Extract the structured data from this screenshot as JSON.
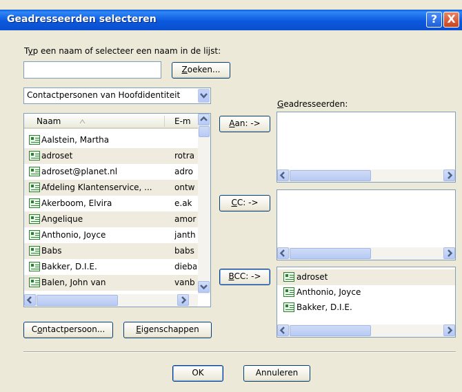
{
  "window": {
    "title": "Geadresseerden selecteren"
  },
  "title_controls": {
    "help": "?",
    "close": "X"
  },
  "search": {
    "prompt_prefix": "T",
    "prompt_ul": "y",
    "prompt_rest": "p een naam of selecteer een naam in de lijst:",
    "value": "",
    "button_ul": "Z",
    "button_rest": "oeken..."
  },
  "addressbook_combo": {
    "selected": "Contactpersonen van Hoofdidentiteit"
  },
  "contacts_list": {
    "columns": [
      "Naam",
      "E-m"
    ],
    "rows": [
      {
        "name": "Aalstein, Martha",
        "email": ""
      },
      {
        "name": "adroset",
        "email": "rotra"
      },
      {
        "name": "adroset@planet.nl",
        "email": "adro"
      },
      {
        "name": "Afdeling Klantenservice, ...",
        "email": "ontw"
      },
      {
        "name": "Akerboom, Elvira",
        "email": "e.ak"
      },
      {
        "name": "Angelique",
        "email": "amor"
      },
      {
        "name": "Anthonio, Joyce",
        "email": "janth"
      },
      {
        "name": "Babs",
        "email": "babs"
      },
      {
        "name": "Bakker, D.I.E.",
        "email": "dieba"
      },
      {
        "name": "Balen, John van",
        "email": "vanb"
      }
    ]
  },
  "buttons": {
    "to_ul": "A",
    "to_rest": "an: ->",
    "cc_ul": "C",
    "cc_rest": "C: ->",
    "bcc_ul": "B",
    "bcc_rest": "CC: ->",
    "contact_pre": "C",
    "contact_ul": "o",
    "contact_rest": "ntactpersoon...",
    "properties_ul": "E",
    "properties_rest": "igenschappen",
    "ok": "OK",
    "cancel": "Annuleren"
  },
  "recipients": {
    "label_ul": "G",
    "label_rest": "eadresseerden:",
    "to": [],
    "cc": [],
    "bcc": [
      "adroset",
      "Anthonio, Joyce",
      "Bakker, D.I.E."
    ]
  },
  "scroll_glyphs": {
    "up": "▲",
    "down": "▼",
    "left": "◀",
    "right": "▶",
    "grip": "⁞"
  }
}
